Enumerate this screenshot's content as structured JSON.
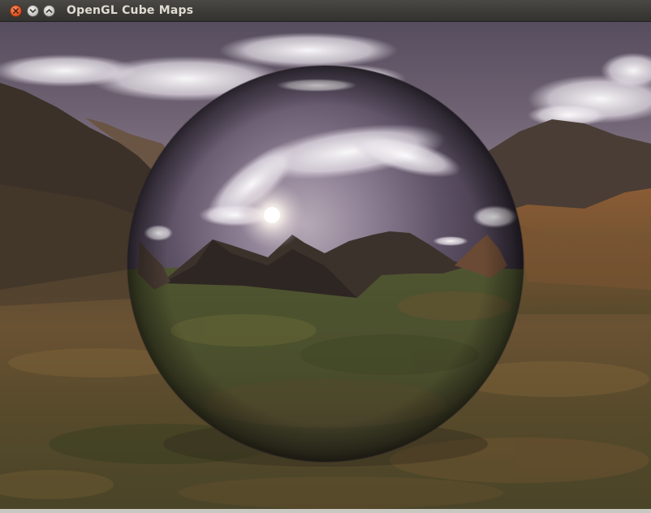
{
  "window": {
    "title": "OpenGL Cube Maps",
    "buttons": {
      "close": "close",
      "minimize": "minimize",
      "maximize": "maximize"
    }
  },
  "scene": {
    "skybox": "sky-and-mountains",
    "object": "reflective-sphere",
    "colors": {
      "sky_top": "#5e5565",
      "sky_horizon": "#b8a6ad",
      "ground": "#4f4a2c",
      "titlebar": "#3c3b37",
      "close_button": "#e2592a"
    }
  }
}
